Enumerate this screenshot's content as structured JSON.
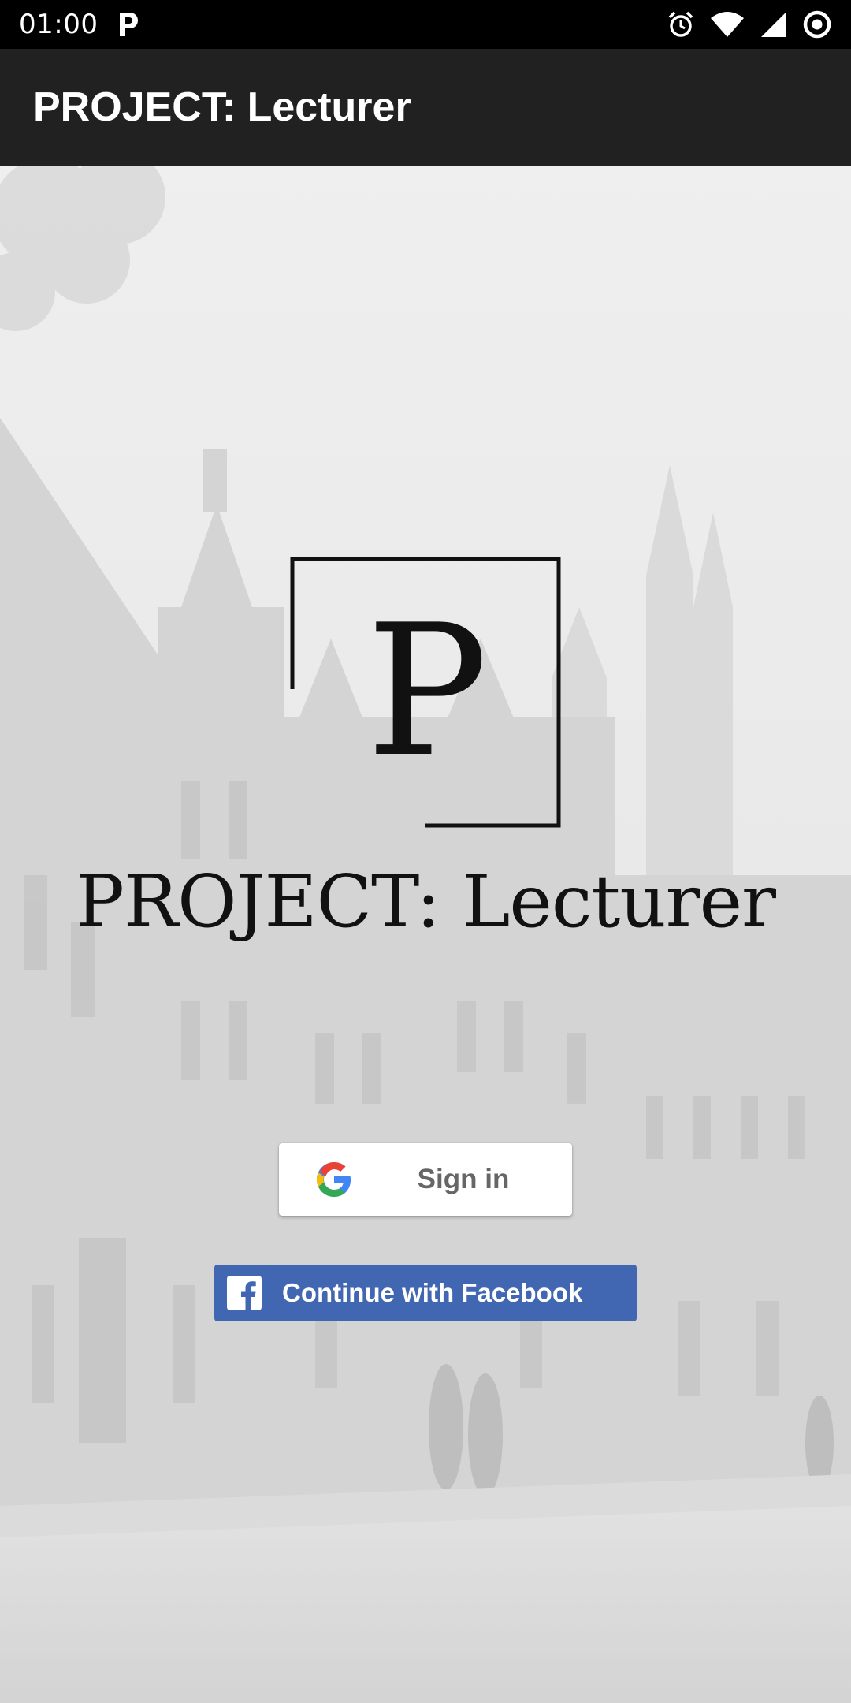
{
  "status_bar": {
    "time": "01:00",
    "icons": [
      "p-app-icon",
      "alarm-icon",
      "wifi-icon",
      "signal-icon",
      "sync-icon"
    ]
  },
  "app_bar": {
    "title": "PROJECT: Lecturer"
  },
  "brand": {
    "logo_letter": "P",
    "title": "PROJECT: Lecturer"
  },
  "google_sign_in": {
    "label": "Sign in",
    "icon": "google-icon"
  },
  "facebook_login": {
    "label": "Continue with Facebook",
    "icon": "facebook-icon",
    "color": "#4267b2"
  },
  "colors": {
    "app_bar": "#212121",
    "status_bar": "#000000",
    "background": "#dcdcdc"
  }
}
